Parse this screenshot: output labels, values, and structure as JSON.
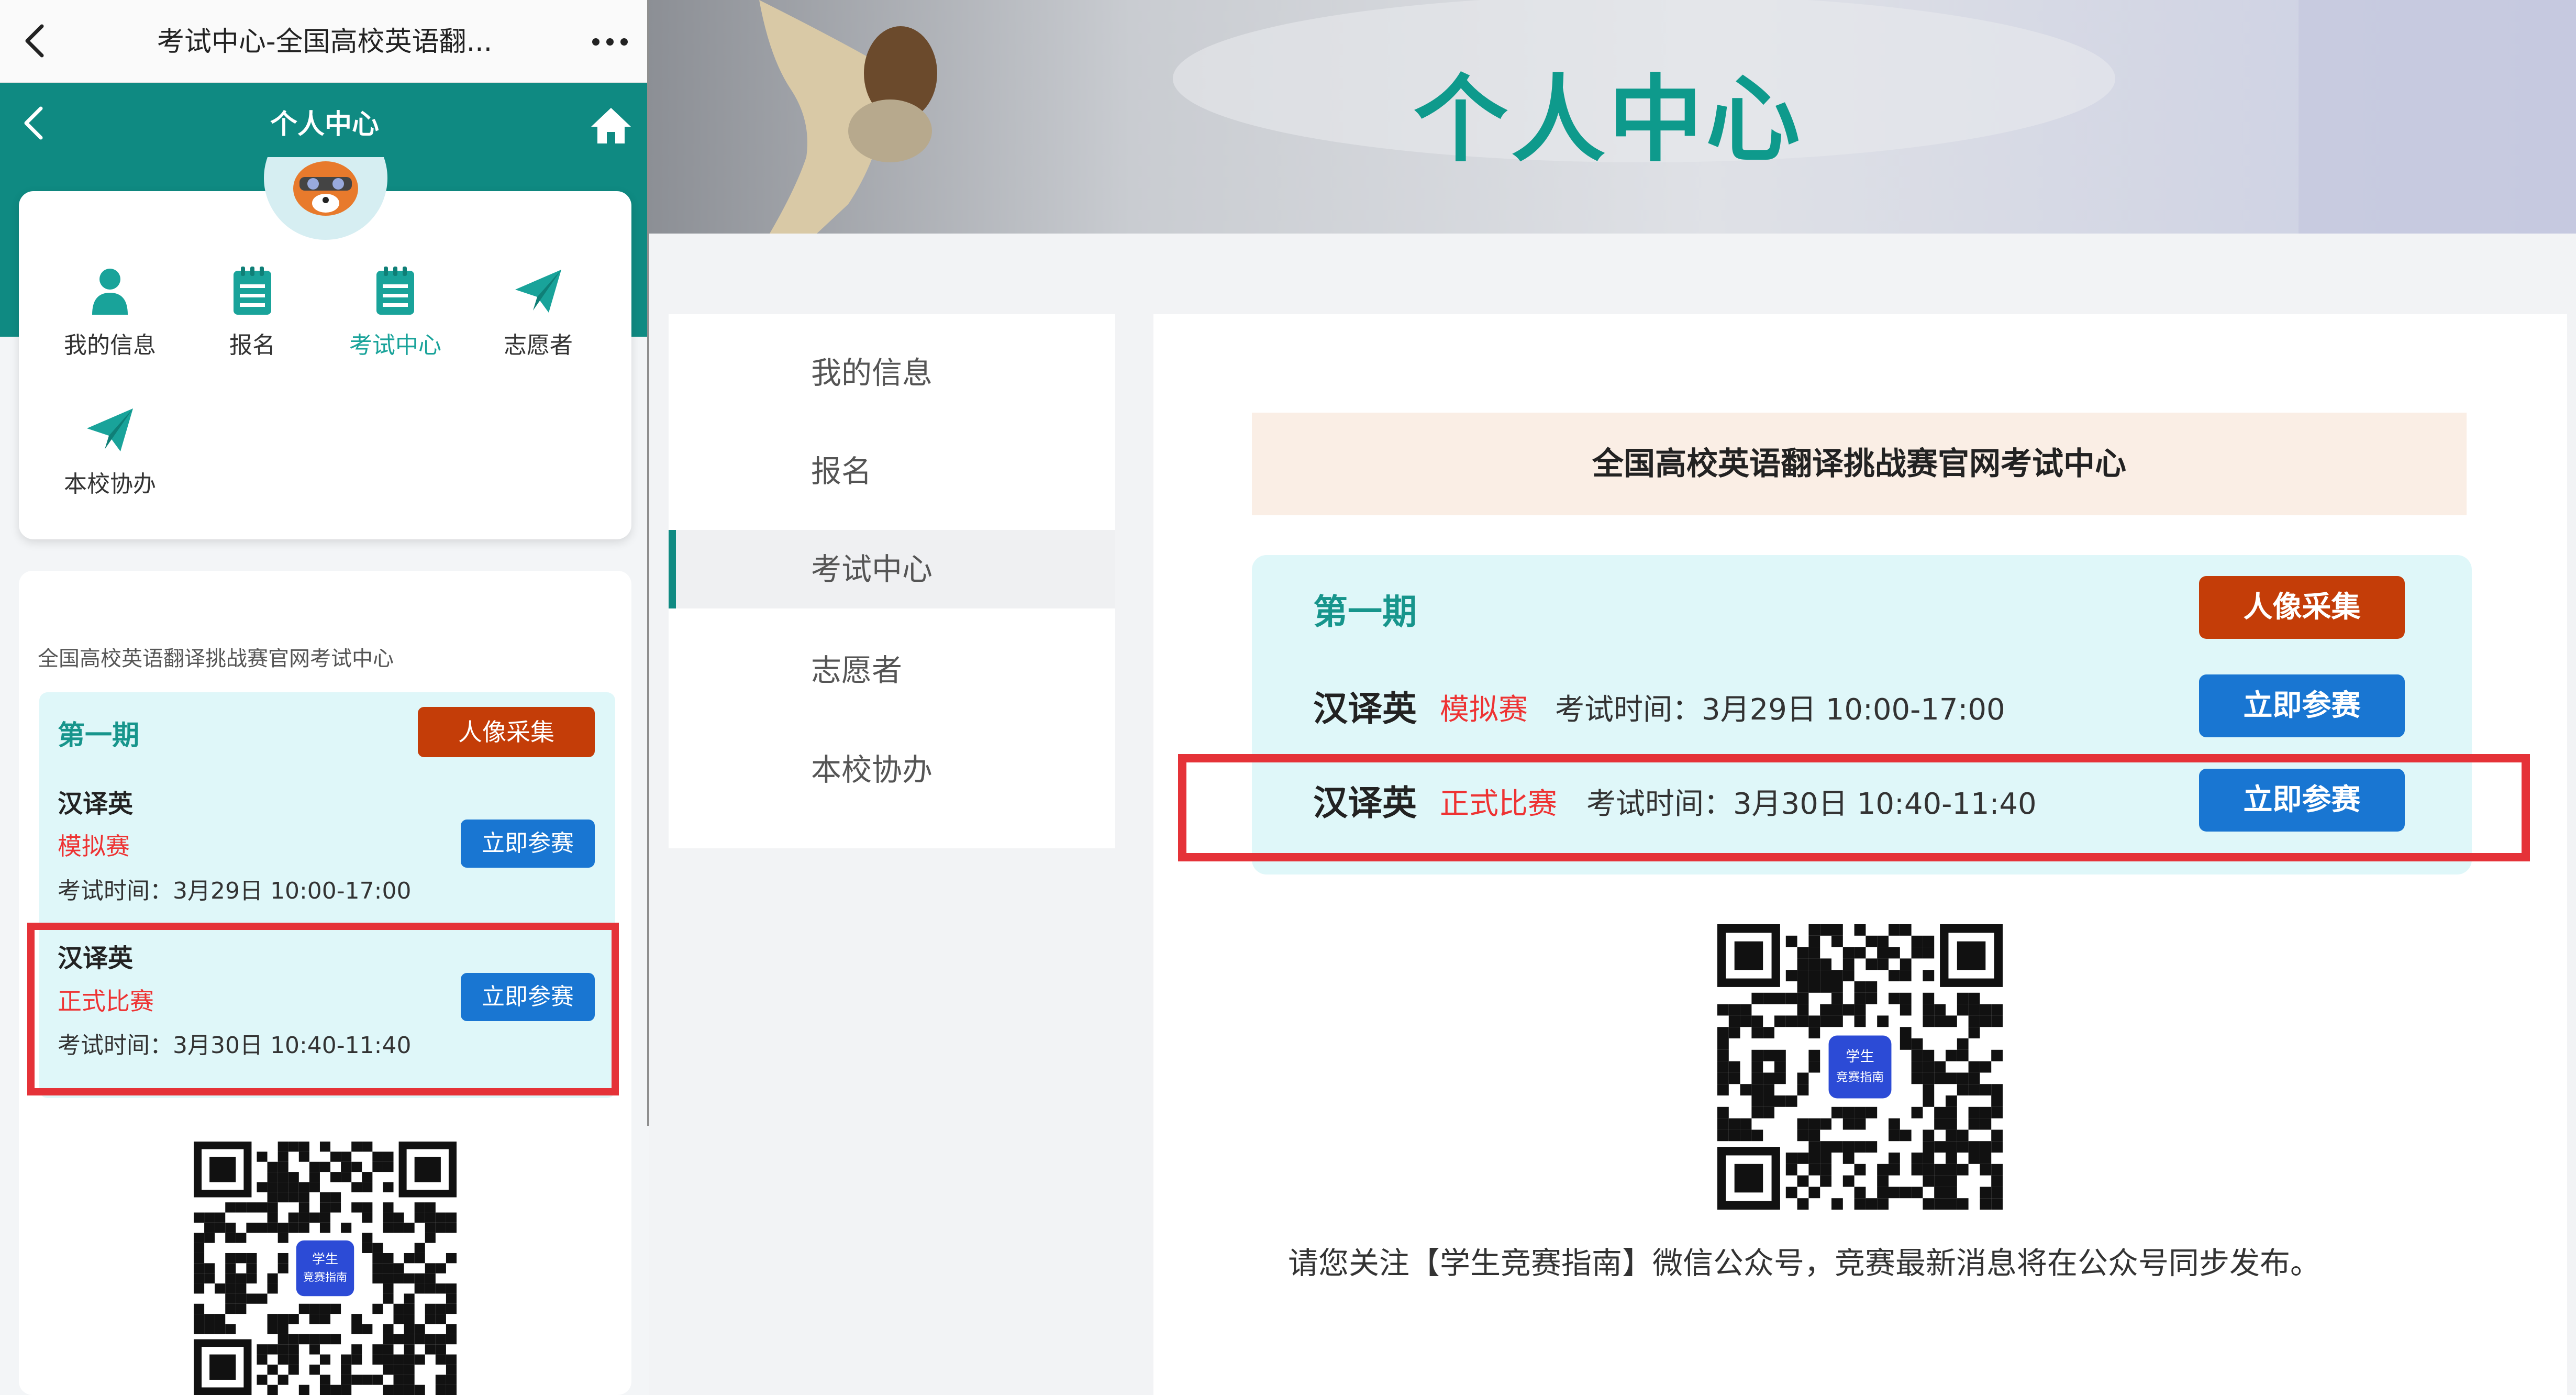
{
  "mobile": {
    "browser_title": "考试中心-全国高校英语翻...",
    "nav_title": "个人中心",
    "icons": {
      "back": "back-chevron-icon",
      "more": "more-dots-icon",
      "home": "home-icon"
    },
    "menu": [
      {
        "label": "我的信息",
        "icon": "user-icon"
      },
      {
        "label": "报名",
        "icon": "notepad-icon"
      },
      {
        "label": "考试中心",
        "icon": "notepad-icon",
        "active": true
      },
      {
        "label": "志愿者",
        "icon": "paper-plane-icon"
      },
      {
        "label": "本校协办",
        "icon": "paper-plane-icon"
      }
    ],
    "section_title": "全国高校英语翻译挑战赛官网考试中心",
    "period": {
      "label": "第一期",
      "photo_button": "人像采集",
      "rows": [
        {
          "name": "汉译英",
          "type": "模拟赛",
          "time": "考试时间：3月29日 10:00-17:00",
          "button": "立即参赛"
        },
        {
          "name": "汉译英",
          "type": "正式比赛",
          "time": "考试时间：3月30日 10:40-11:40",
          "button": "立即参赛"
        }
      ]
    },
    "qr_logo": [
      "学生",
      "竞赛指南"
    ]
  },
  "desktop": {
    "banner_title": "个人中心",
    "sidebar": [
      {
        "label": "我的信息"
      },
      {
        "label": "报名"
      },
      {
        "label": "考试中心",
        "active": true
      },
      {
        "label": "志愿者"
      },
      {
        "label": "本校协办"
      }
    ],
    "main_title": "全国高校英语翻译挑战赛官网考试中心",
    "period": {
      "label": "第一期",
      "photo_button": "人像采集",
      "rows": [
        {
          "name": "汉译英",
          "type": "模拟赛",
          "time": "考试时间：3月29日 10:00-17:00",
          "button": "立即参赛"
        },
        {
          "name": "汉译英",
          "type": "正式比赛",
          "time": "考试时间：3月30日 10:40-11:40",
          "button": "立即参赛"
        }
      ]
    },
    "qr_logo": [
      "学生",
      "竞赛指南"
    ],
    "notice": "请您关注【学生竞赛指南】微信公众号，竞赛最新消息将在公众号同步发布。"
  },
  "colors": {
    "teal": "#0f8a82",
    "accent_teal": "#17958c",
    "orange": "#c43d08",
    "blue": "#1976d2",
    "red": "#e53238",
    "light_cyan": "#dff7f9",
    "peach": "#faeee5"
  }
}
